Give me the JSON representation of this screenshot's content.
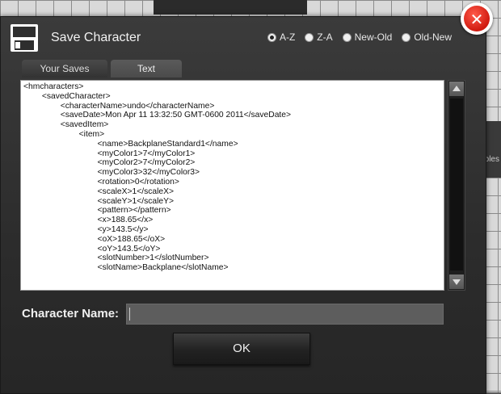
{
  "dialog": {
    "title": "Save Character",
    "icon": "floppy-disk-icon",
    "close_icon": "close-x-icon",
    "close_color": "#e3281c"
  },
  "sort": {
    "options": [
      "A-Z",
      "Z-A",
      "New-Old",
      "Old-New"
    ],
    "selected": "A-Z"
  },
  "tabs": [
    {
      "label": "Your Saves",
      "active": false
    },
    {
      "label": "Text",
      "active": true
    }
  ],
  "xml_lines": [
    "<hmcharacters>",
    "        <savedCharacter>",
    "                <characterName>undo</characterName>",
    "                <saveDate>Mon Apr 11 13:32:50 GMT-0600 2011</saveDate>",
    "                <savedItem>",
    "                        <item>",
    "                                <name>BackplaneStandard1</name>",
    "                                <myColor1>7</myColor1>",
    "                                <myColor2>7</myColor2>",
    "                                <myColor3>32</myColor3>",
    "                                <rotation>0</rotation>",
    "                                <scaleX>1</scaleX>",
    "                                <scaleY>1</scaleY>",
    "                                <pattern></pattern>",
    "                                <x>188.65</x>",
    "                                <y>143.5</y>",
    "                                <oX>188.65</oX>",
    "                                <oY>143.5</oY>",
    "                                <slotNumber>1</slotNumber>",
    "                                <slotName>Backplane</slotName>"
  ],
  "character_name": {
    "label": "Character Name:",
    "value": ""
  },
  "ok_label": "OK",
  "background": {
    "side_label": "bles"
  }
}
